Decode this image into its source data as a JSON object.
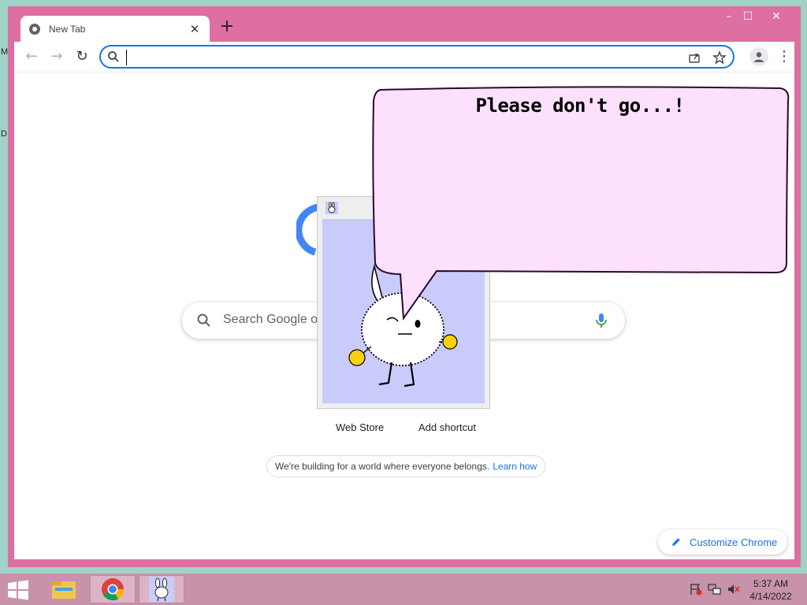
{
  "desktop": {
    "label_top": "M",
    "label_mid": "D"
  },
  "browser": {
    "tab": {
      "title": "New Tab",
      "close": "✕"
    },
    "new_tab": "+",
    "window_controls": {
      "minimize": "–",
      "maximize": "☐",
      "close": "✕"
    },
    "nav": {
      "back": "←",
      "forward": "→",
      "reload": "↻"
    },
    "omnibox": {
      "value": ""
    },
    "menu": "⋮",
    "accent": "#1a73e8",
    "frame_color": "#dd6fa3"
  },
  "newtab": {
    "search_placeholder": "Search Google or",
    "shortcuts": [
      {
        "label": "Web Store"
      },
      {
        "label": "Add shortcut"
      }
    ],
    "notice": {
      "text": "We're building for a world where everyone belongs.",
      "link": "Learn how"
    },
    "customize_label": "Customize Chrome"
  },
  "mascot": {
    "speech": "Please don't go...!",
    "bubble_color": "#fde0fb",
    "canvas_color": "#c9cbfb"
  },
  "taskbar": {
    "time": "5:37 AM",
    "date": "4/14/2022",
    "color": "#c792aa",
    "apps": [
      "file-explorer-icon",
      "chrome-icon",
      "bunny-mascot-icon"
    ],
    "tray": [
      "flag-alert-icon",
      "network-icon",
      "volume-muted-icon"
    ]
  }
}
